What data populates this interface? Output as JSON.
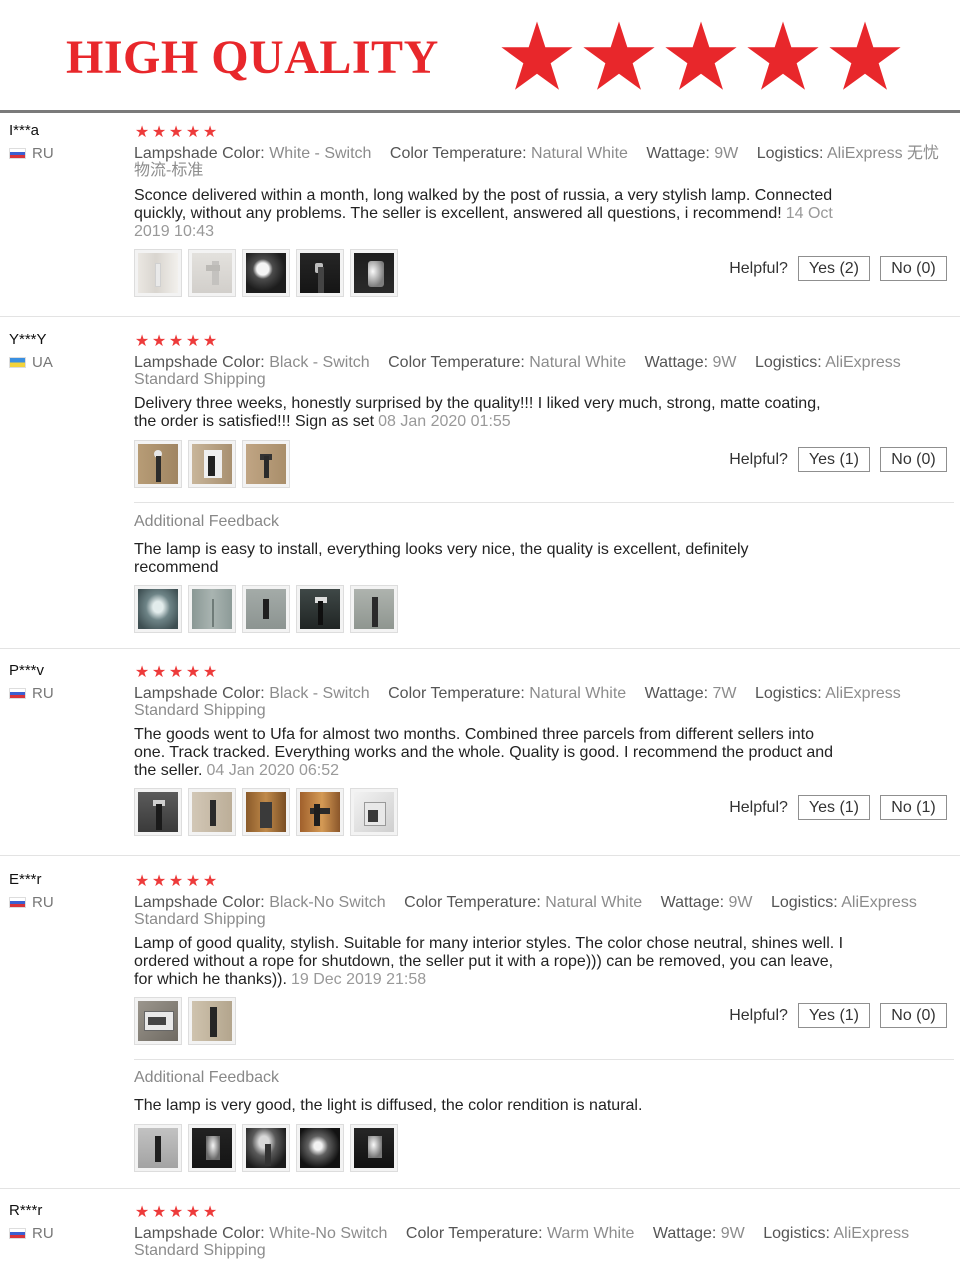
{
  "banner": {
    "title": "HIGH QUALITY",
    "stars": 5,
    "star_color": "#e8272b"
  },
  "labels": {
    "lampshade": "Lampshade Color:",
    "temperature": "Color Temperature:",
    "wattage": "Wattage:",
    "logistics": "Logistics:",
    "helpful": "Helpful?",
    "additional_feedback": "Additional Feedback"
  },
  "reviews": [
    {
      "user": "I***a",
      "country": "RU",
      "rating": 5,
      "lampshade": "White - Switch",
      "temperature": "Natural White",
      "wattage": "9W",
      "logistics": "AliExpress 无忧物流-标准",
      "text": "Sconce delivered within a month, long walked by the post of russia, a very stylish lamp. Connected quickly, without any problems. The seller is excellent, answered all questions, i recommend!",
      "date": "14 Oct 2019 10:43",
      "yes": "Yes (2)",
      "no": "No (0)"
    },
    {
      "user": "Y***Y",
      "country": "UA",
      "rating": 5,
      "lampshade": "Black - Switch",
      "temperature": "Natural White",
      "wattage": "9W",
      "logistics": "AliExpress Standard Shipping",
      "text": "Delivery three weeks, honestly surprised by the quality!!! I liked very much, strong, matte coating, the order is satisfied!!! Sign as set",
      "date": "08 Jan 2020 01:55",
      "yes": "Yes (1)",
      "no": "No (0)",
      "additional": "The lamp is easy to install, everything looks very nice, the quality is excellent, definitely recommend"
    },
    {
      "user": "P***v",
      "country": "RU",
      "rating": 5,
      "lampshade": "Black - Switch",
      "temperature": "Natural White",
      "wattage": "7W",
      "logistics": "AliExpress Standard Shipping",
      "text": "The goods went to Ufa for almost two months. Combined three parcels from different sellers into one. Track tracked. Everything works and the whole. Quality is good. I recommend the product and the seller.",
      "date": "04 Jan 2020 06:52",
      "yes": "Yes (1)",
      "no": "No (1)"
    },
    {
      "user": "E***r",
      "country": "RU",
      "rating": 5,
      "lampshade": "Black-No Switch",
      "temperature": "Natural White",
      "wattage": "9W",
      "logistics": "AliExpress Standard Shipping",
      "text": "Lamp of good quality, stylish. Suitable for many interior styles. The color chose neutral, shines well. I ordered without a rope for shutdown, the seller put it with a rope))) can be removed, you can leave, for which he thanks)).",
      "date": "19 Dec 2019 21:58",
      "yes": "Yes (1)",
      "no": "No (0)",
      "additional": "The lamp is very good, the light is diffused, the color rendition is natural."
    },
    {
      "user": "R***r",
      "country": "RU",
      "rating": 5,
      "lampshade": "White-No Switch",
      "temperature": "Warm White",
      "wattage": "9W",
      "logistics": "AliExpress Standard Shipping"
    }
  ],
  "colors": {
    "star": "#ed3b3b",
    "muted_text": "#8c8c8c",
    "separator": "#e3e3e3"
  }
}
